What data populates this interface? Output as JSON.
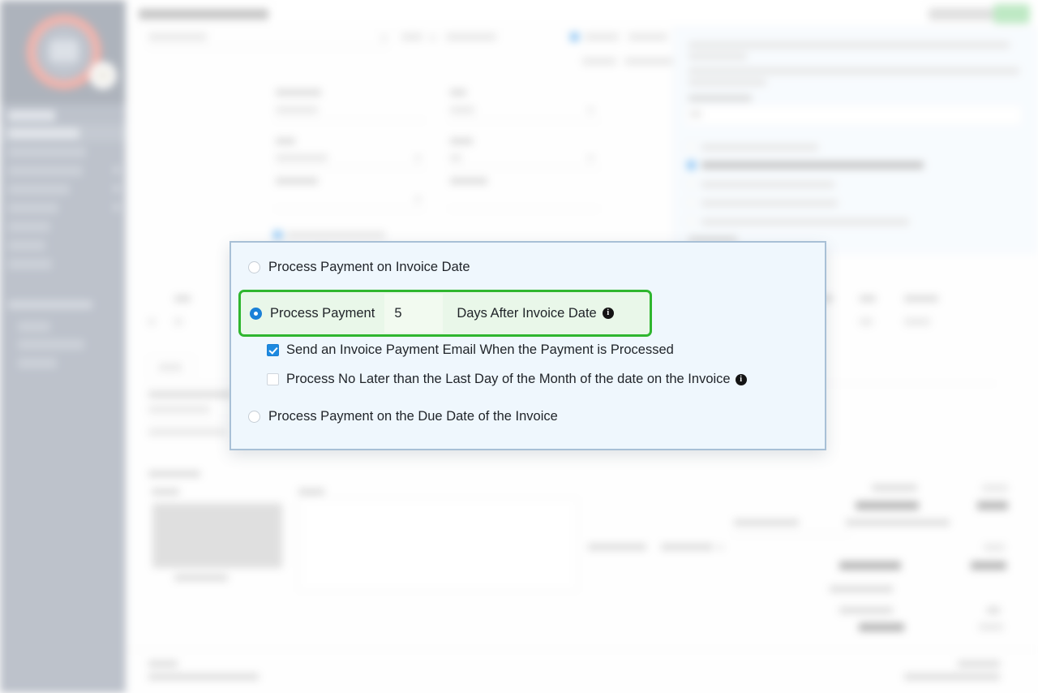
{
  "app": {
    "page_title": "Edit Recurring Invoice",
    "header_buttons": {
      "secondary_label": "Cancel",
      "primary_label": "Save"
    },
    "footer_note": "Invoice",
    "footer_note_sub": "Thank you for your business"
  },
  "sidebar": {
    "logo_name": "app-logo",
    "items": [
      {
        "label": "Home"
      },
      {
        "label": "Dashboard"
      },
      {
        "label": "Customers"
      },
      {
        "label": "Recurring Invoices"
      },
      {
        "label": "Invoices"
      },
      {
        "label": "Quotes"
      },
      {
        "label": "Payments"
      },
      {
        "label": "Credits"
      },
      {
        "label": "Projects"
      },
      {
        "label": "Tasks"
      },
      {
        "label": "Expenses"
      }
    ],
    "section_label": "Advanced Settings",
    "section_items": [
      {
        "label": "Settings"
      },
      {
        "label": "Tax Settings"
      },
      {
        "label": "Reports"
      }
    ]
  },
  "form": {
    "fields": [
      {
        "label": "Client"
      },
      {
        "label": "Frequency"
      },
      {
        "label": "Remaining Cycles"
      },
      {
        "label": "Due Date"
      },
      {
        "label": "Invoice Number"
      },
      {
        "label": "PO Number"
      },
      {
        "label": "Discount"
      },
      {
        "label": "Start Date"
      },
      {
        "label": "Public Notes"
      },
      {
        "label": "Private Notes"
      },
      {
        "label": "Terms"
      }
    ],
    "auto_bill_label": "Auto Bill Enabled"
  },
  "right_panel": {
    "note_label": "Invoice Footer Text",
    "options": [
      {
        "label": "Show tasks on invoice PDF"
      },
      {
        "label": "Auto bill the invoice on the due date",
        "checked": true
      },
      {
        "label": "Attach PDF to invoice email"
      },
      {
        "label": "Attach documents to invoice"
      },
      {
        "label": "Show product images on the invoice PDF"
      }
    ],
    "sub_label": "Attachments"
  },
  "totals": {
    "rows": [
      {
        "label": "Subtotal",
        "value": "0.00"
      },
      {
        "label": "Credit Applied",
        "value": "0.00"
      },
      {
        "label": "Discount / Surcharge",
        "value": ""
      },
      {
        "label": "Payment Type",
        "value": "0.00"
      },
      {
        "label": "Invoice Total",
        "value": "0.00"
      },
      {
        "label": "Amount Paid",
        "value": ""
      },
      {
        "label": "Balance Due",
        "value": "0.00"
      }
    ],
    "total_emphasis_label": "Invoice Total",
    "partial_label": "Partial / Deposit"
  },
  "table": {
    "columns": [
      "Item",
      "Description",
      "Unit Cost",
      "Quantity",
      "Tax",
      "Line Total"
    ],
    "add_item_label": "Add Item"
  },
  "lower": {
    "section_label": "Invoice Details",
    "signature_label": "Signature",
    "notes_label": "Terms"
  },
  "modal": {
    "name": "auto-bill-settings-dialog",
    "options": [
      {
        "id": "on-invoice-date",
        "label": "Process Payment on Invoice Date",
        "selected": false
      },
      {
        "id": "days-after-invoice-date",
        "label_before": "Process Payment",
        "days_value": "5",
        "days_placeholder": "",
        "label_after": "Days After Invoice Date",
        "selected": true,
        "has_info_icon": true,
        "info_icon": "info-icon"
      },
      {
        "id": "on-due-date",
        "label": "Process Payment on the Due Date of the Invoice",
        "selected": false
      }
    ],
    "checkboxes": [
      {
        "id": "send-email",
        "label": "Send an Invoice Payment Email When the Payment is Processed",
        "checked": true,
        "has_info_icon": false
      },
      {
        "id": "no-later-than-last-day",
        "label": "Process No Later than the Last Day of the Month of the date on the Invoice",
        "checked": false,
        "has_info_icon": true,
        "info_icon": "info-icon"
      }
    ],
    "info_glyph": "i"
  },
  "colors": {
    "modal_border": "#a8c0d6",
    "modal_bg": "#eff7fd",
    "highlight_green": "#2fb62f",
    "highlight_green_bg": "#e9f7e9",
    "radio_selected_blue": "#1a81d8",
    "checkbox_checked_blue": "#1e8ae0",
    "sidebar_bg": "#8d96a6",
    "logo_ring": "#ea7e70",
    "primary_button_green": "#8fd99a"
  }
}
